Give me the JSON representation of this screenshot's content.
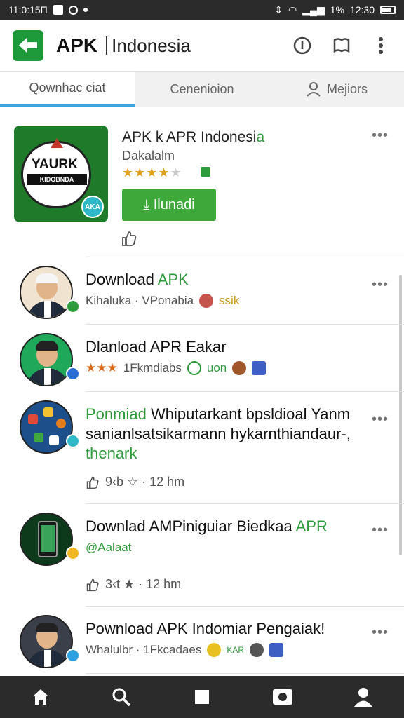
{
  "status_bar": {
    "time": "11:0:15П",
    "battery": "1%",
    "clock_right": "12:30"
  },
  "app_bar": {
    "brand": "APK",
    "title": "Indonesia"
  },
  "tabs": [
    {
      "label": "Qownhac ciat"
    },
    {
      "label": "Cenenioion"
    },
    {
      "label": "Mejiors"
    }
  ],
  "featured": {
    "title_main": "APK k APR Indonesi",
    "title_accent": "a",
    "subtitle": "Dakalalm",
    "rating": 4,
    "art_title": "YAURK",
    "art_band": "KIDOBNDA",
    "art_badge": "AKA",
    "install_label": "Ilunadi"
  },
  "items": [
    {
      "title_main": "Download ",
      "title_accent": "APK",
      "meta": "Kihaluka · VPonabia",
      "meta_accent": "ssik"
    },
    {
      "title_main": "Dlanload APR Eakar",
      "meta": "1Fkmdiabs",
      "meta_accent": "uon"
    },
    {
      "title_a": "Ponmiad",
      "title_b": " Whiputarkant bpsldioal Yanm sanianlsatsikarmann hykarnthiandaur-,",
      "title_c": "thenark",
      "stats": "9‹b ☆ · 12 hm"
    },
    {
      "title_main": "Downlad AMPiniguiar Biedkaa ",
      "title_accent": "APR",
      "meta_accent": "@Aalaat",
      "stats": "3‹t ★ · 12 hm"
    },
    {
      "title_main": "Pownload APK Indomiar Pengaiak!",
      "meta": "Whalulbr · 1Fkcadaes",
      "meta_accent": "KAR"
    }
  ],
  "colors": {
    "brand_green": "#1e9a3a",
    "accent_green": "#2e9b3c",
    "tab_underline": "#3aa4e0",
    "install_green": "#3fa83a",
    "star_gold": "#e0a020"
  },
  "icons": [
    "home-icon",
    "search-icon",
    "square-icon",
    "photo-icon",
    "person-icon"
  ]
}
